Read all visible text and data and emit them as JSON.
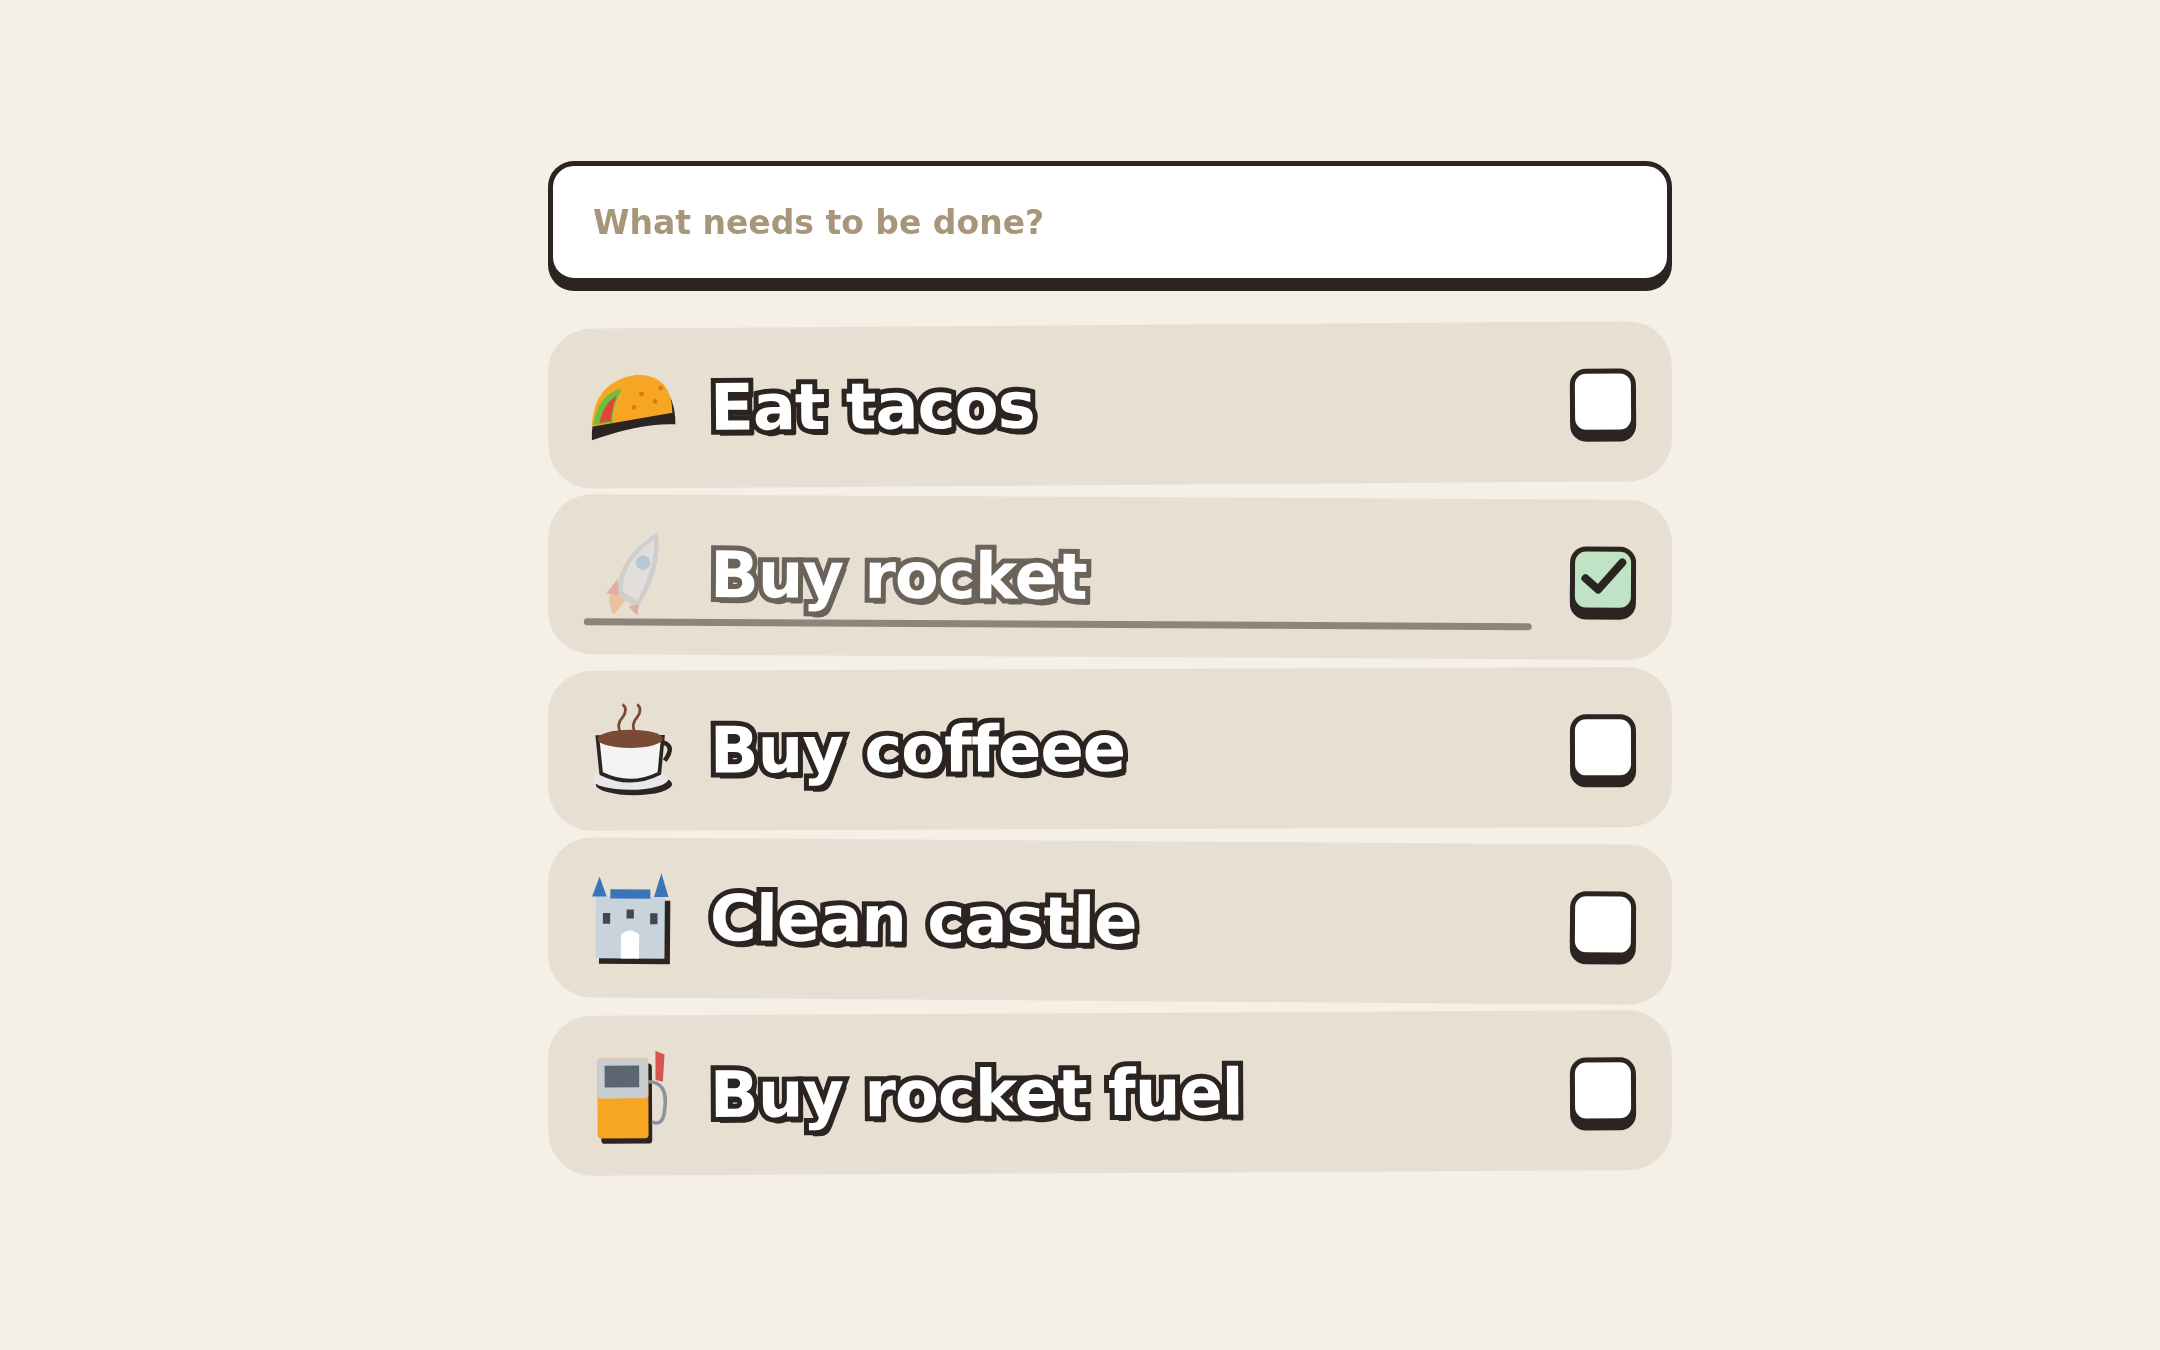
{
  "input": {
    "placeholder": "What needs to be done?"
  },
  "todos": [
    {
      "label": "Eat tacos",
      "kind": "taco",
      "done": false
    },
    {
      "label": "Buy rocket",
      "kind": "rocket",
      "done": true
    },
    {
      "label": "Buy coffeee",
      "kind": "coffee",
      "done": false
    },
    {
      "label": "Clean castle",
      "kind": "castle",
      "done": false
    },
    {
      "label": "Buy rocket fuel",
      "kind": "fuel",
      "done": false
    }
  ]
}
